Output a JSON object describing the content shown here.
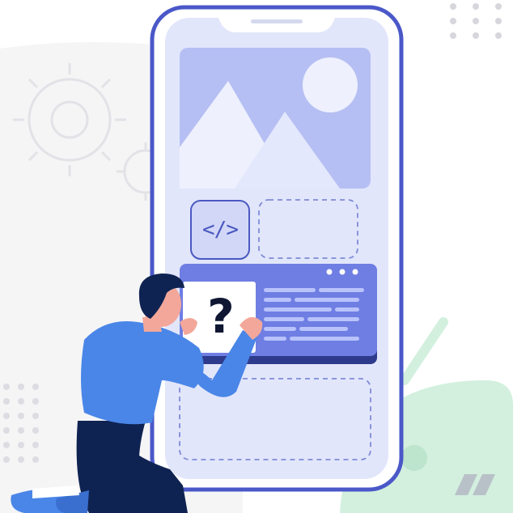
{
  "illustration": {
    "code_symbol": "</>",
    "question_symbol": "?",
    "icons": [
      "gear-icon",
      "image-placeholder-icon",
      "code-icon",
      "question-icon",
      "android-icon"
    ],
    "colors": {
      "phone_frame": "#4a58c8",
      "phone_screen": "#e2e6fb",
      "image_block": "#b5bff3",
      "window_panel": "#6f7ee3",
      "shirt": "#4a86e8",
      "pants": "#0f2352",
      "android_green": "#d3f0df",
      "background_gray": "#f4f4f4"
    }
  }
}
